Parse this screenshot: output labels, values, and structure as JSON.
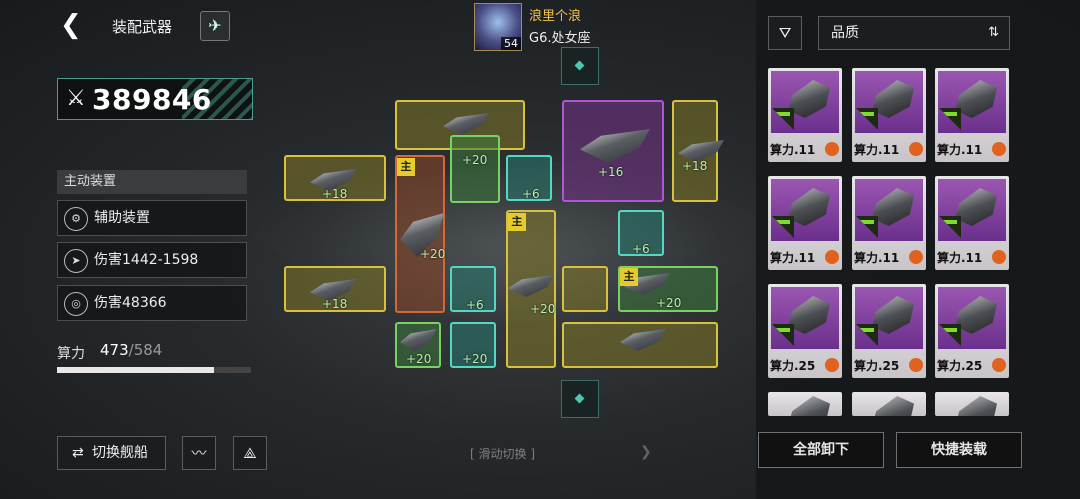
{
  "header": {
    "back_icon": "back-arrow-icon",
    "title": "装配武器",
    "rocket_icon": "rocket-icon"
  },
  "player": {
    "name": "浪里个浪",
    "rank": "G6.处女座",
    "level": "54"
  },
  "power": {
    "value": "389846",
    "icon": "crossed-swords-icon"
  },
  "stats": {
    "section_title": "主动装置",
    "items": [
      {
        "icon": "support-device-icon",
        "label": "辅助装置"
      },
      {
        "icon": "missile-icon",
        "label": "伤害1442-1598"
      },
      {
        "icon": "target-icon",
        "label": "伤害48366"
      }
    ]
  },
  "calc": {
    "label": "算力",
    "used": "473",
    "max": "/584",
    "fraction": 0.81
  },
  "bottom": {
    "switch_label": "切换舰船",
    "switch_icon": "swap-icon",
    "wave_icon": "wave-icon",
    "fleet_icon": "fleet-icon",
    "slide_label": "滑动切换"
  },
  "grid": {
    "bonuses": [
      "+18",
      "+20",
      "+16",
      "+18",
      "+6",
      "+20",
      "+6",
      "+18",
      "+6",
      "+20",
      "+20",
      "+20",
      "+20"
    ],
    "main_tag": "主"
  },
  "right": {
    "filter_icon": "filter-icon",
    "quality_label": "品质",
    "sort_icon": "sort-icon",
    "cards": [
      {
        "cost": "算力.11"
      },
      {
        "cost": "算力.11"
      },
      {
        "cost": "算力.11"
      },
      {
        "cost": "算力.11"
      },
      {
        "cost": "算力.11"
      },
      {
        "cost": "算力.11"
      },
      {
        "cost": "算力.25"
      },
      {
        "cost": "算力.25"
      },
      {
        "cost": "算力.25"
      }
    ],
    "unequip_label": "全部卸下",
    "quick_label": "快捷装载"
  },
  "colors": {
    "yellow": "#d9c13e",
    "green": "#79d064",
    "purple": "#b055d8",
    "orange": "#d16a3a",
    "teal": "#52d8c4",
    "accent": "#4fc7b0"
  }
}
